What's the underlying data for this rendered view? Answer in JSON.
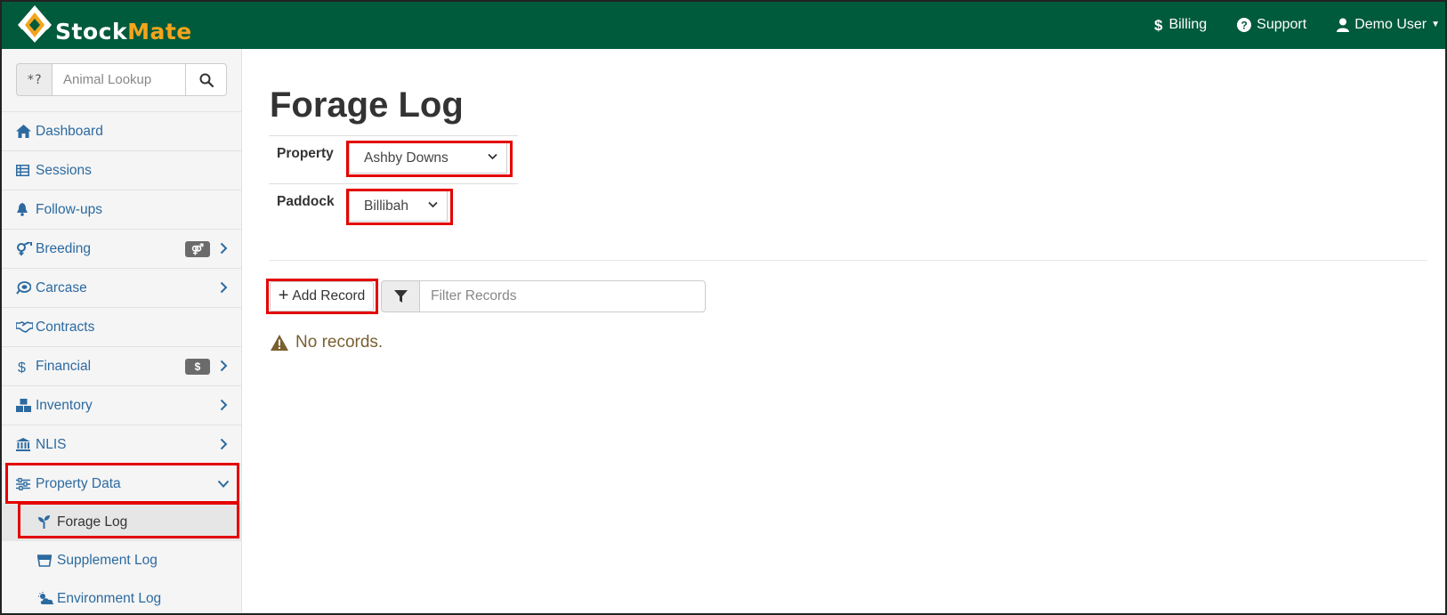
{
  "brand": {
    "name_part1": "Stock",
    "name_part2": "Mate"
  },
  "topnav": {
    "billing": "Billing",
    "support": "Support",
    "user": "Demo User"
  },
  "sidebar": {
    "search_prefix": "*?",
    "search_placeholder": "Animal Lookup",
    "items": [
      {
        "label": "Dashboard",
        "icon": "home-icon"
      },
      {
        "label": "Sessions",
        "icon": "table-icon"
      },
      {
        "label": "Follow-ups",
        "icon": "bell-icon"
      },
      {
        "label": "Breeding",
        "icon": "gender-icon",
        "badge": "⚤",
        "expandable": true
      },
      {
        "label": "Carcase",
        "icon": "meat-icon",
        "expandable": true
      },
      {
        "label": "Contracts",
        "icon": "handshake-icon"
      },
      {
        "label": "Financial",
        "icon": "dollar-icon",
        "badge": "$",
        "expandable": true
      },
      {
        "label": "Inventory",
        "icon": "boxes-icon",
        "expandable": true
      },
      {
        "label": "NLIS",
        "icon": "bank-icon",
        "expandable": true
      },
      {
        "label": "Property Data",
        "icon": "sliders-icon",
        "expanded": true
      }
    ],
    "subitems": [
      {
        "label": "Forage Log",
        "icon": "seedling-icon",
        "selected": true
      },
      {
        "label": "Supplement Log",
        "icon": "bucket-icon"
      },
      {
        "label": "Environment Log",
        "icon": "cloud-sun-icon"
      }
    ]
  },
  "main": {
    "title": "Forage Log",
    "property_label": "Property",
    "property_value": "Ashby Downs",
    "paddock_label": "Paddock",
    "paddock_value": "Billibah",
    "add_button": "Add Record",
    "filter_placeholder": "Filter Records",
    "empty_message": "No records."
  },
  "colors": {
    "navbar": "#005a3c",
    "brand_accent": "#f3a51c",
    "link": "#2c6aa0",
    "highlight": "#e50000",
    "warning_text": "#7a6030"
  }
}
